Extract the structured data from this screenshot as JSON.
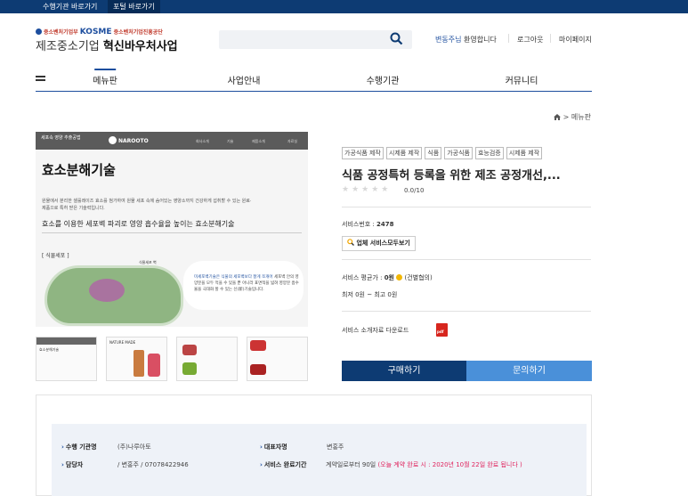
{
  "topbar": {
    "link1": "수행기관 바로가기",
    "link2": "포털 바로가기"
  },
  "header": {
    "ministry": "중소벤처기업부",
    "agency_logo": "KOSME",
    "agency_sub": "중소벤처기업진흥공단",
    "title_prefix": "제조중소기업",
    "title_main": "혁신바우처사업",
    "search": {
      "placeholder": "",
      "value": ""
    }
  },
  "user": {
    "name": "변동주님",
    "greeting": "환영합니다",
    "logout": "로그아웃",
    "mypage": "마이페이지"
  },
  "nav": {
    "items": [
      "메뉴판",
      "사업안내",
      "수행기관",
      "커뮤니티"
    ]
  },
  "breadcrumb": {
    "current": "메뉴판"
  },
  "hero": {
    "band_title": "세포속 영양 추출공법",
    "brand": "NAROOTO",
    "nav_mini": [
      "회사소개",
      "기술",
      "제품소개",
      "자료실"
    ],
    "title": "효소분해기술",
    "desc": "원물에서 분리한 셀룰레이즈 효소를 첨가하여 원물 세포 속에 숨어있는 영양소까지 건강하게 섭취할 수 있는 원료·제품으로 특허 받은 기술력입니다.",
    "subtitle": "효소를 이용한 세포벽 파괴로 영양 흡수율을 높이는 효소분해기술",
    "tag": "[ 식물세포 ]",
    "cell_note": "식물세포 벽",
    "bubble_text_highlight": "미세포벽기술은 식물의 세포벽보다 잘게 쪼개어",
    "bubble_text": "세포벽 안의 영양분을 모두 먹을 수 있을 뿐 아니라 표면적을 넓혀 영양분 흡수율을 극대화 할 수 있는 신(新)기술입니다."
  },
  "thumbnails": [
    "효소분해기술",
    "NATURE MADE",
    "",
    ""
  ],
  "product": {
    "tags": [
      "가공식품 제작",
      "시제품 제작",
      "식품",
      "가공식품",
      "효능검증",
      "시제품 제작"
    ],
    "title": "식품 공정특허 등록을 위한 제조 공정개선,...",
    "stars": "★★★★★",
    "rating": "0.0/10",
    "service_no_label": "서비스번호 :",
    "service_no": "2478",
    "company_button": "업체 서비스모두보기",
    "avg_label": "서비스 평균가 :",
    "avg_value": "0원",
    "avg_note": "(건별협의)",
    "range": "최저 0원 ~ 최고 0원",
    "download_label": "서비스 소개자료 다운로드",
    "buy_button": "구매하기",
    "inquiry_button": "문의하기"
  },
  "info": {
    "org_label": "수행 기관명",
    "org_value": "(주)나루아토",
    "rep_label": "대표자명",
    "rep_value": "변홍주",
    "manager_label": "담당자",
    "manager_value": "/ 변홍주 / 07078422946",
    "period_label": "서비스 완료기간",
    "period_value": "계약일로부터 90일",
    "period_note": "(오늘 계약 완료 시 : 2020년 10월 22일 완료 됩니다 )"
  },
  "colors": {
    "primary": "#0d3b73",
    "accent": "#4a90d9",
    "highlight": "#e0245e"
  }
}
